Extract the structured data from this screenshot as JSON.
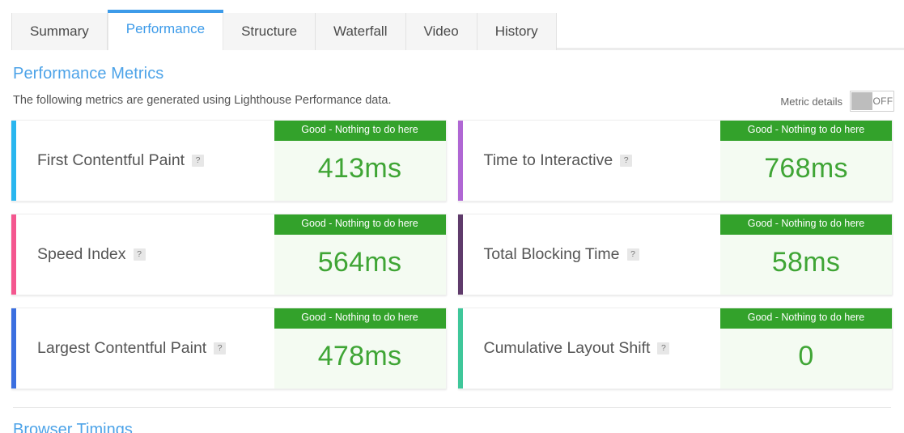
{
  "tabs": [
    {
      "label": "Summary",
      "active": false
    },
    {
      "label": "Performance",
      "active": true
    },
    {
      "label": "Structure",
      "active": false
    },
    {
      "label": "Waterfall",
      "active": false
    },
    {
      "label": "Video",
      "active": false
    },
    {
      "label": "History",
      "active": false
    }
  ],
  "section": {
    "title": "Performance Metrics",
    "subtitle": "The following metrics are generated using Lighthouse Performance data."
  },
  "metric_details": {
    "label": "Metric details",
    "state": "OFF",
    "on": false
  },
  "help_icon": "?",
  "colors": {
    "accent_blue": "#3d9be9",
    "status_green": "#33a22b",
    "value_green": "#3fa535",
    "value_bg": "#f4fbf2"
  },
  "metrics": [
    {
      "name": "First Contentful Paint",
      "status": "Good - Nothing to do here",
      "value": "413ms",
      "accent": "#29b6ef"
    },
    {
      "name": "Time to Interactive",
      "status": "Good - Nothing to do here",
      "value": "768ms",
      "accent": "#b067d4"
    },
    {
      "name": "Speed Index",
      "status": "Good - Nothing to do here",
      "value": "564ms",
      "accent": "#f4578f"
    },
    {
      "name": "Total Blocking Time",
      "status": "Good - Nothing to do here",
      "value": "58ms",
      "accent": "#5f3b6b"
    },
    {
      "name": "Largest Contentful Paint",
      "status": "Good - Nothing to do here",
      "value": "478ms",
      "accent": "#3b6fe0"
    },
    {
      "name": "Cumulative Layout Shift",
      "status": "Good - Nothing to do here",
      "value": "0",
      "accent": "#3fc79a"
    }
  ],
  "next_section": {
    "title": "Browser Timings"
  }
}
